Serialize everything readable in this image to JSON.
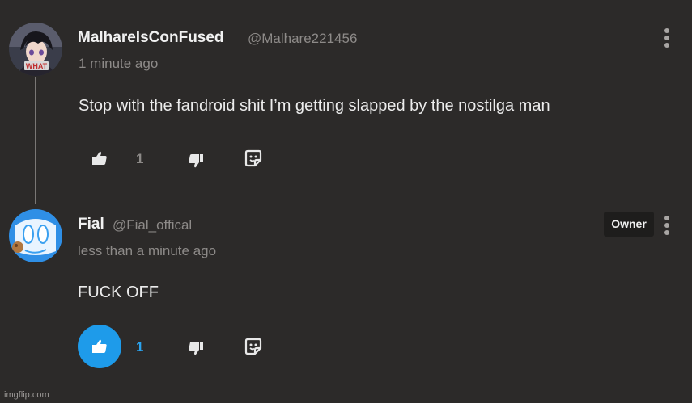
{
  "colors": {
    "background": "#2c2a29",
    "accent": "#1e9bea",
    "muted_text": "#8d8a88"
  },
  "comments": [
    {
      "username": "MalhareIsConFused",
      "handle": "@Malhare221456",
      "timestamp": "1 minute ago",
      "text": "Stop with the fandroid shit I’m getting slapped by the nostilga man",
      "likes": "1",
      "liked": false,
      "avatar_text": "WHAT"
    },
    {
      "username": "Fial",
      "handle": "@Fial_offical",
      "timestamp": "less than a minute ago",
      "badge": "Owner",
      "text": "FUCK OFF",
      "likes": "1",
      "liked": true
    }
  ],
  "icons": {
    "like": "thumbs-up-icon",
    "dislike": "thumbs-down-icon",
    "reply": "reply-sticker-icon",
    "menu": "more-vertical-icon"
  },
  "watermark": "imgflip.com"
}
